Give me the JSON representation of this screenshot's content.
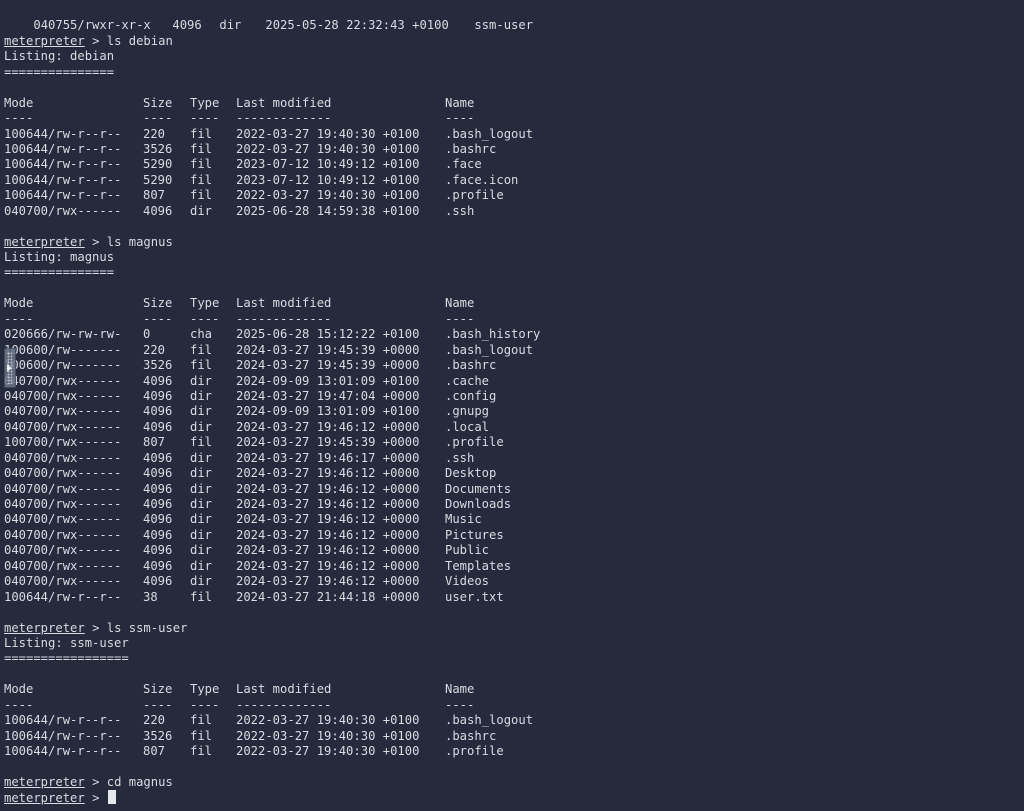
{
  "colors": {
    "background": "#252a3d",
    "text": "#d8dbe2",
    "cursor": "#e6e8ee"
  },
  "prompt": {
    "name": "meterpreter",
    "symbol": ">"
  },
  "top_row": {
    "mode": "040755/rwxr-xr-x",
    "size": "4096",
    "type": "dir",
    "modified": "2025-05-28 22:32:43 +0100",
    "name": "ssm-user"
  },
  "header": {
    "mode": "Mode",
    "size": "Size",
    "type": "Type",
    "modified": "Last modified",
    "name": "Name",
    "mode_ul": "----",
    "size_ul": "----",
    "type_ul": "----",
    "modified_ul": "-------------",
    "name_ul": "----"
  },
  "blocks": [
    {
      "command": "ls debian",
      "listing": "Listing: debian",
      "separator": "===============",
      "rows": [
        {
          "mode": "100644/rw-r--r--",
          "size": "220",
          "type": "fil",
          "modified": "2022-03-27 19:40:30 +0100",
          "name": ".bash_logout"
        },
        {
          "mode": "100644/rw-r--r--",
          "size": "3526",
          "type": "fil",
          "modified": "2022-03-27 19:40:30 +0100",
          "name": ".bashrc"
        },
        {
          "mode": "100644/rw-r--r--",
          "size": "5290",
          "type": "fil",
          "modified": "2023-07-12 10:49:12 +0100",
          "name": ".face"
        },
        {
          "mode": "100644/rw-r--r--",
          "size": "5290",
          "type": "fil",
          "modified": "2023-07-12 10:49:12 +0100",
          "name": ".face.icon"
        },
        {
          "mode": "100644/rw-r--r--",
          "size": "807",
          "type": "fil",
          "modified": "2022-03-27 19:40:30 +0100",
          "name": ".profile"
        },
        {
          "mode": "040700/rwx------",
          "size": "4096",
          "type": "dir",
          "modified": "2025-06-28 14:59:38 +0100",
          "name": ".ssh"
        }
      ]
    },
    {
      "command": "ls magnus",
      "listing": "Listing: magnus",
      "separator": "===============",
      "rows": [
        {
          "mode": "020666/rw-rw-rw-",
          "size": "0",
          "type": "cha",
          "modified": "2025-06-28 15:12:22 +0100",
          "name": ".bash_history"
        },
        {
          "mode": "100600/rw-------",
          "size": "220",
          "type": "fil",
          "modified": "2024-03-27 19:45:39 +0000",
          "name": ".bash_logout"
        },
        {
          "mode": "100600/rw-------",
          "size": "3526",
          "type": "fil",
          "modified": "2024-03-27 19:45:39 +0000",
          "name": ".bashrc"
        },
        {
          "mode": "040700/rwx------",
          "size": "4096",
          "type": "dir",
          "modified": "2024-09-09 13:01:09 +0100",
          "name": ".cache"
        },
        {
          "mode": "040700/rwx------",
          "size": "4096",
          "type": "dir",
          "modified": "2024-03-27 19:47:04 +0000",
          "name": ".config"
        },
        {
          "mode": "040700/rwx------",
          "size": "4096",
          "type": "dir",
          "modified": "2024-09-09 13:01:09 +0100",
          "name": ".gnupg"
        },
        {
          "mode": "040700/rwx------",
          "size": "4096",
          "type": "dir",
          "modified": "2024-03-27 19:46:12 +0000",
          "name": ".local"
        },
        {
          "mode": "100700/rwx------",
          "size": "807",
          "type": "fil",
          "modified": "2024-03-27 19:45:39 +0000",
          "name": ".profile"
        },
        {
          "mode": "040700/rwx------",
          "size": "4096",
          "type": "dir",
          "modified": "2024-03-27 19:46:17 +0000",
          "name": ".ssh"
        },
        {
          "mode": "040700/rwx------",
          "size": "4096",
          "type": "dir",
          "modified": "2024-03-27 19:46:12 +0000",
          "name": "Desktop"
        },
        {
          "mode": "040700/rwx------",
          "size": "4096",
          "type": "dir",
          "modified": "2024-03-27 19:46:12 +0000",
          "name": "Documents"
        },
        {
          "mode": "040700/rwx------",
          "size": "4096",
          "type": "dir",
          "modified": "2024-03-27 19:46:12 +0000",
          "name": "Downloads"
        },
        {
          "mode": "040700/rwx------",
          "size": "4096",
          "type": "dir",
          "modified": "2024-03-27 19:46:12 +0000",
          "name": "Music"
        },
        {
          "mode": "040700/rwx------",
          "size": "4096",
          "type": "dir",
          "modified": "2024-03-27 19:46:12 +0000",
          "name": "Pictures"
        },
        {
          "mode": "040700/rwx------",
          "size": "4096",
          "type": "dir",
          "modified": "2024-03-27 19:46:12 +0000",
          "name": "Public"
        },
        {
          "mode": "040700/rwx------",
          "size": "4096",
          "type": "dir",
          "modified": "2024-03-27 19:46:12 +0000",
          "name": "Templates"
        },
        {
          "mode": "040700/rwx------",
          "size": "4096",
          "type": "dir",
          "modified": "2024-03-27 19:46:12 +0000",
          "name": "Videos"
        },
        {
          "mode": "100644/rw-r--r--",
          "size": "38",
          "type": "fil",
          "modified": "2024-03-27 21:44:18 +0000",
          "name": "user.txt"
        }
      ]
    },
    {
      "command": "ls ssm-user",
      "listing": "Listing: ssm-user",
      "separator": "=================",
      "rows": [
        {
          "mode": "100644/rw-r--r--",
          "size": "220",
          "type": "fil",
          "modified": "2022-03-27 19:40:30 +0100",
          "name": ".bash_logout"
        },
        {
          "mode": "100644/rw-r--r--",
          "size": "3526",
          "type": "fil",
          "modified": "2022-03-27 19:40:30 +0100",
          "name": ".bashrc"
        },
        {
          "mode": "100644/rw-r--r--",
          "size": "807",
          "type": "fil",
          "modified": "2022-03-27 19:40:30 +0100",
          "name": ".profile"
        }
      ]
    }
  ],
  "final_command": "cd magnus",
  "icons": {
    "side_handle": "collapse-handle-icon"
  }
}
